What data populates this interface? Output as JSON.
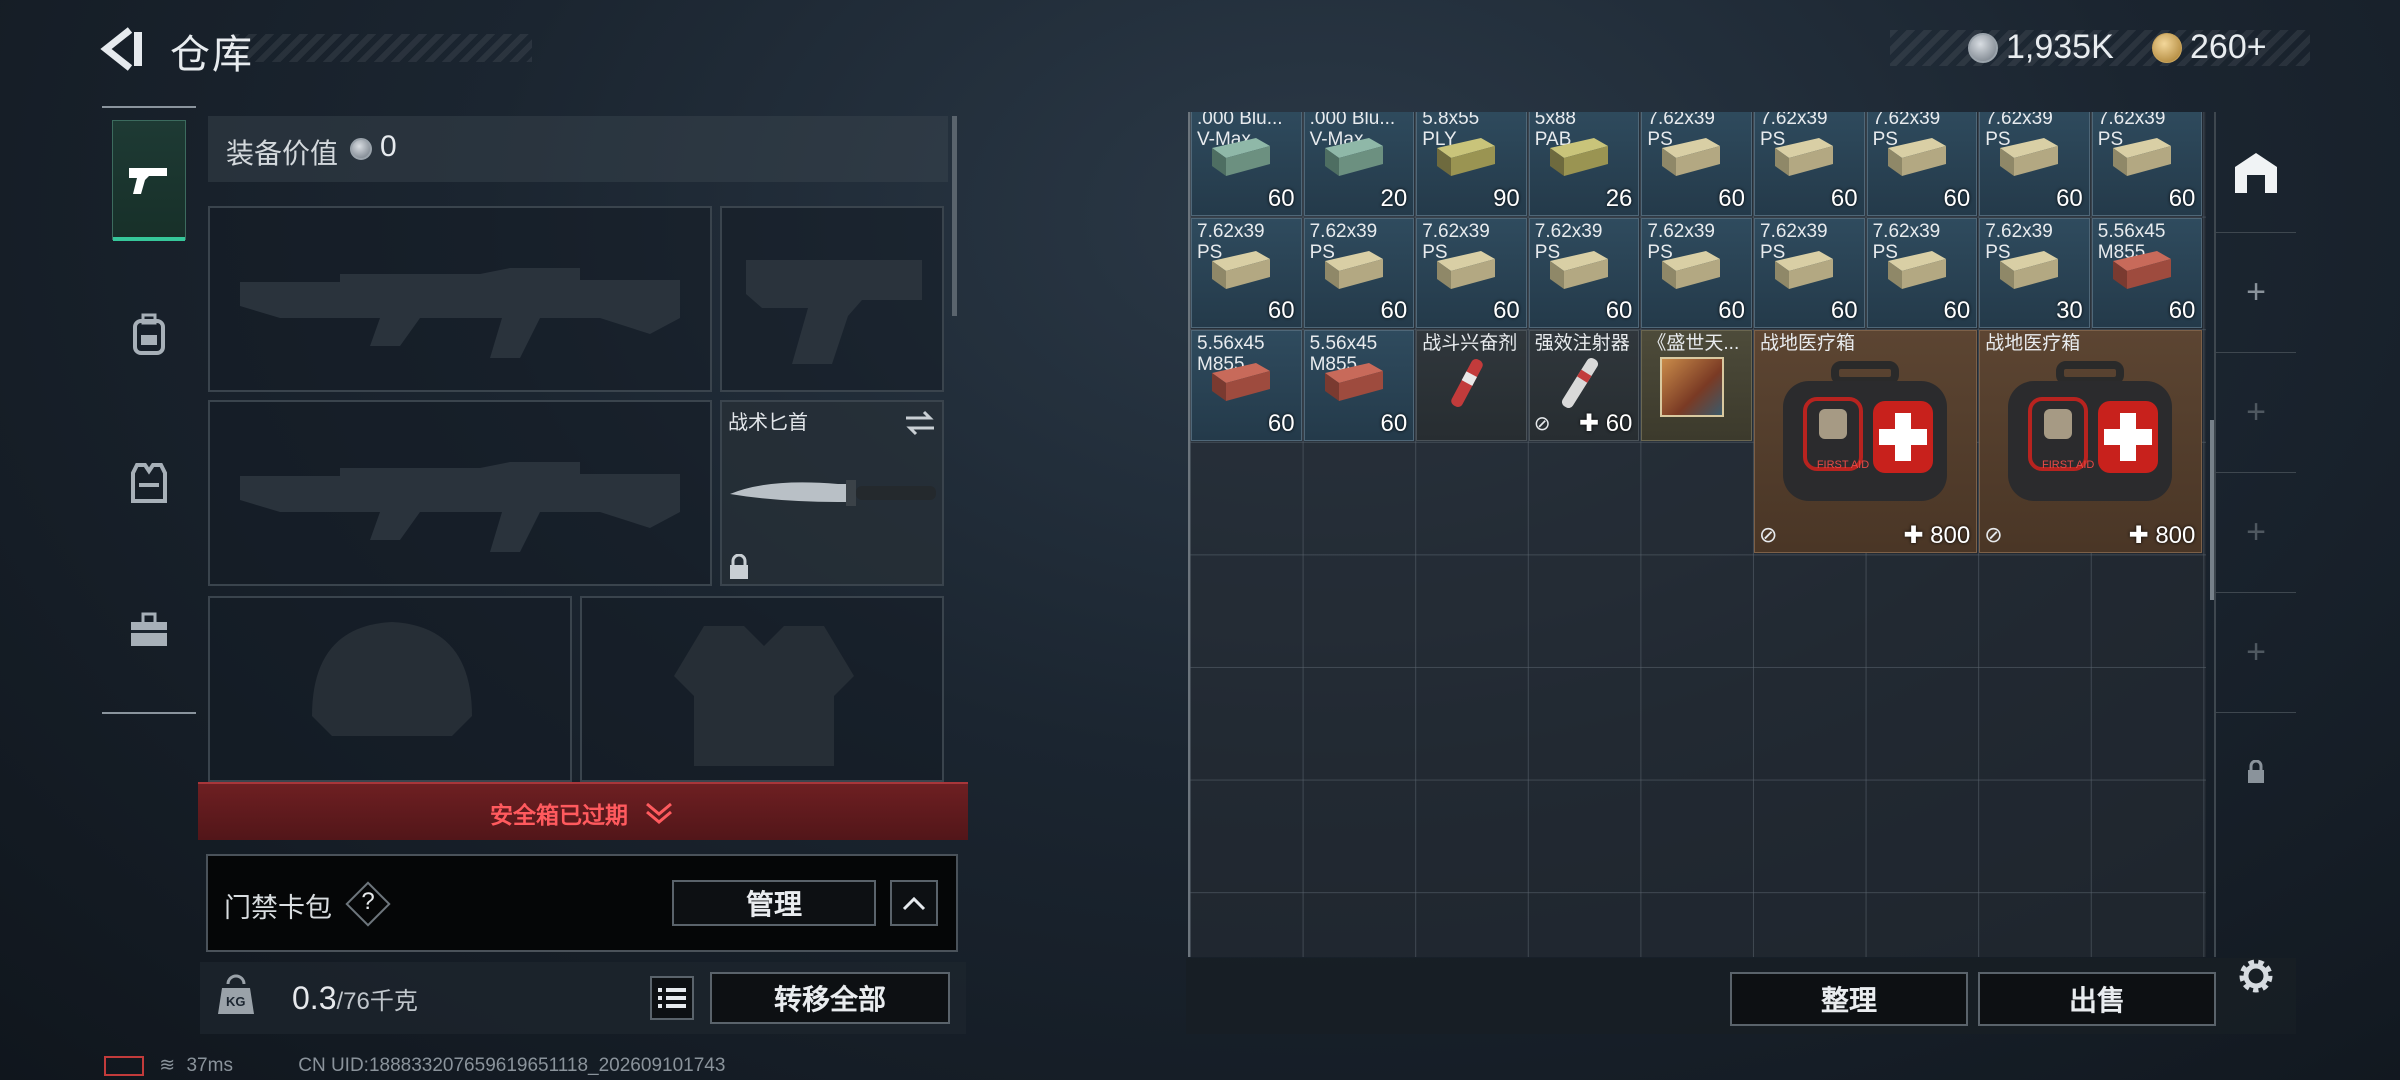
{
  "header": {
    "title": "仓库",
    "currencies": [
      {
        "icon": "silver-coin-icon",
        "value": "1,935K"
      },
      {
        "icon": "gold-coin-icon",
        "value": "260+"
      }
    ]
  },
  "sidebar": {
    "tabs": [
      {
        "icon": "pistol-icon",
        "active": true
      },
      {
        "icon": "backpack-icon",
        "active": false
      },
      {
        "icon": "vest-icon",
        "active": false
      },
      {
        "icon": "toolbox-icon",
        "active": false
      }
    ]
  },
  "loadout": {
    "value_label": "装备价值",
    "value": "0",
    "secondary_slot_title": "战术匕首",
    "safebox_status": "安全箱已过期",
    "card_pack_label": "门禁卡包",
    "help_mark": "?",
    "manage_label": "管理",
    "weight_current": "0.3",
    "weight_max": "/76千克",
    "weight_icon_text": "KG",
    "transfer_all_label": "转移全部"
  },
  "stash": {
    "row0": [
      {
        "name": ".000 Blu...\nV-Max",
        "count": "60"
      },
      {
        "name": ".000 Blu...\nV-Max",
        "count": "20"
      },
      {
        "name": "5.8x55\nPLY",
        "count": "90"
      },
      {
        "name": "5x88\nPAB",
        "count": "26"
      },
      {
        "name": "7.62x39\nPS",
        "count": "60"
      },
      {
        "name": "7.62x39\nPS",
        "count": "60"
      },
      {
        "name": "7.62x39\nPS",
        "count": "60"
      },
      {
        "name": "7.62x39\nPS",
        "count": "60"
      },
      {
        "name": "7.62x39\nPS",
        "count": "60"
      }
    ],
    "row1": [
      {
        "name": "7.62x39\nPS",
        "count": "60"
      },
      {
        "name": "7.62x39\nPS",
        "count": "60"
      },
      {
        "name": "7.62x39\nPS",
        "count": "60"
      },
      {
        "name": "7.62x39\nPS",
        "count": "60"
      },
      {
        "name": "7.62x39\nPS",
        "count": "60"
      },
      {
        "name": "7.62x39\nPS",
        "count": "60"
      },
      {
        "name": "7.62x39\nPS",
        "count": "60"
      },
      {
        "name": "7.62x39\nPS",
        "count": "30"
      },
      {
        "name": "5.56x45\nM855",
        "count": "60"
      }
    ],
    "row2": [
      {
        "name": "5.56x45\nM855",
        "count": "60"
      },
      {
        "name": "5.56x45\nM855",
        "count": "60"
      },
      {
        "name": "战斗兴奋剂",
        "count": ""
      },
      {
        "name": "强效注射器",
        "count": "60"
      },
      {
        "name": "《盛世天...",
        "count": ""
      }
    ],
    "medkits": [
      {
        "name": "战地医疗箱",
        "count": "800"
      },
      {
        "name": "战地医疗箱",
        "count": "800"
      }
    ],
    "first_aid_text": "FIRST AID"
  },
  "actions": {
    "sort_label": "整理",
    "sell_label": "出售"
  },
  "status_bar": {
    "ping": "37ms",
    "uid": "CN UID:188833207659619651118_202609101743"
  }
}
